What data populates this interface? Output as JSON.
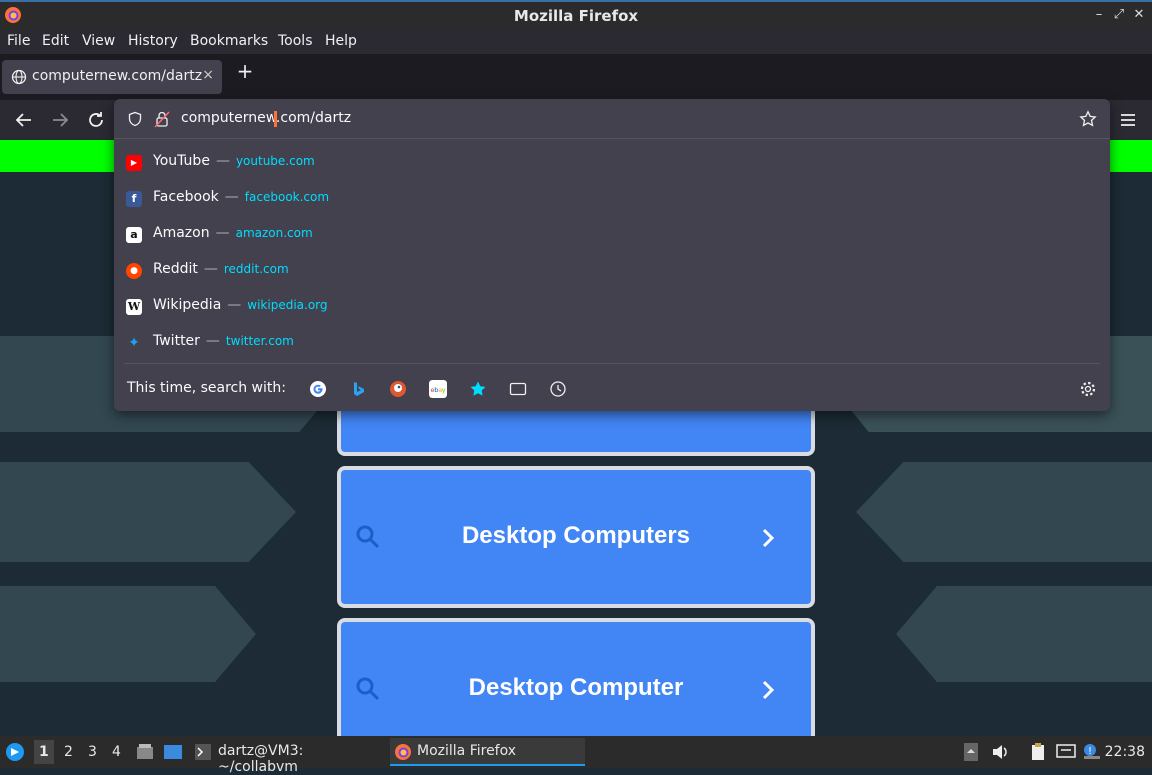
{
  "window": {
    "title": "Mozilla Firefox"
  },
  "menubar": {
    "items": [
      "File",
      "Edit",
      "View",
      "History",
      "Bookmarks",
      "Tools",
      "Help"
    ]
  },
  "tab": {
    "label": "computernew.com/dartz",
    "close": "×"
  },
  "newtab": "+",
  "urlbar": {
    "value": "computernew.com/dartz"
  },
  "suggestions": [
    {
      "title": "YouTube",
      "domain": "youtube.com",
      "icon": "youtube-icon",
      "color": "#ff0000"
    },
    {
      "title": "Facebook",
      "domain": "facebook.com",
      "icon": "facebook-icon",
      "color": "#3b5998"
    },
    {
      "title": "Amazon",
      "domain": "amazon.com",
      "icon": "amazon-icon",
      "color": "#ffffff"
    },
    {
      "title": "Reddit",
      "domain": "reddit.com",
      "icon": "reddit-icon",
      "color": "#ff4500"
    },
    {
      "title": "Wikipedia",
      "domain": "wikipedia.org",
      "icon": "wikipedia-icon",
      "color": "#ffffff"
    },
    {
      "title": "Twitter",
      "domain": "twitter.com",
      "icon": "twitter-icon",
      "color": "#1da1f2"
    }
  ],
  "dash": "—",
  "search_with": {
    "label": "This time, search with:"
  },
  "page": {
    "cards": [
      "Desktop Computers",
      "Desktop Computer"
    ]
  },
  "taskbar": {
    "workspaces": [
      "1",
      "2",
      "3",
      "4"
    ],
    "terminal": "dartz@VM3: ~/collabvm",
    "firefox": "Mozilla Firefox",
    "clock": "22:38"
  }
}
